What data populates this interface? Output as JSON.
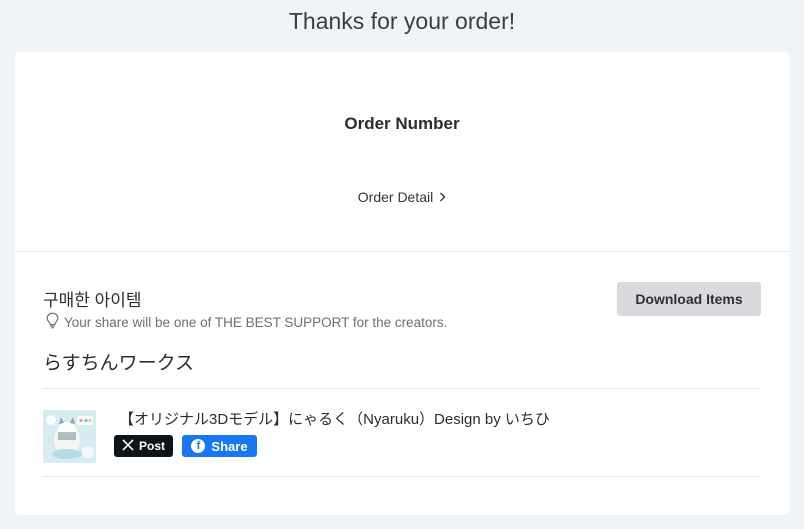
{
  "page": {
    "title": "Thanks for your order!"
  },
  "order": {
    "number_label": "Order Number",
    "detail_label": "Order Detail",
    "detail_chevron": "›"
  },
  "purchased": {
    "title": "구매한 아이템",
    "share_note": "Your share will be one of THE BEST SUPPORT for the creators.",
    "download_label": "Download Items",
    "shop_name": "らすちんワークス",
    "items": [
      {
        "title": "【オリジナル3Dモデル】にゃるく（Nyaruku）Design by いちひ",
        "x_post_label": "Post",
        "fb_share_label": "Share",
        "thumbnail_icon": "product-thumbnail"
      }
    ]
  },
  "colors": {
    "background": "#f1f4f7",
    "card": "#ffffff",
    "download_button": "#d9dadd",
    "x_black": "#0f1419",
    "facebook_blue": "#1877f2"
  },
  "icons": {
    "lightbulb": "lightbulb-icon",
    "chevron": "chevron-right-icon",
    "x_logo": "x-logo-icon",
    "facebook_logo": "facebook-logo-icon"
  }
}
